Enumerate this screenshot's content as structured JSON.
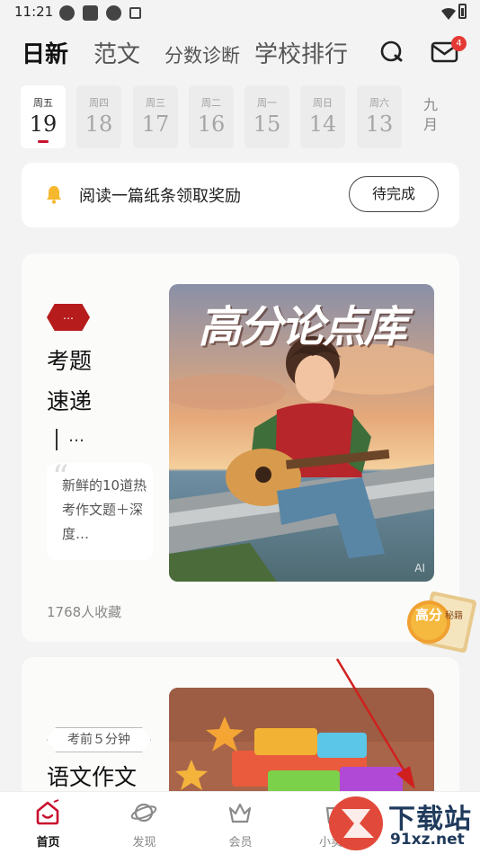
{
  "status_bar": {
    "time": "11:21"
  },
  "header": {
    "tabs": [
      "日新",
      "范文",
      "分数诊断",
      "学校排行"
    ],
    "mail_badge": "4"
  },
  "dates": [
    {
      "week": "周五",
      "day": "19",
      "active": true
    },
    {
      "week": "周四",
      "day": "18"
    },
    {
      "week": "周三",
      "day": "17"
    },
    {
      "week": "周二",
      "day": "16"
    },
    {
      "week": "周一",
      "day": "15"
    },
    {
      "week": "周日",
      "day": "14"
    },
    {
      "week": "周六",
      "day": "13"
    }
  ],
  "month_label": "九月",
  "task": {
    "text": "阅读一篇纸条领取奖励",
    "button": "待完成"
  },
  "card1": {
    "badge": "…",
    "title_line1": "考题",
    "title_line2": "速递",
    "ellipsis": "…",
    "quote": "新鲜的10道热考作文题＋深度…",
    "meta": "1768人收藏",
    "image_title": "高分论点库",
    "image_mark": "AI"
  },
  "sticker": {
    "text_main": "高分",
    "text_sub": "秘籍"
  },
  "card2": {
    "tag": "考前５分钟",
    "title": "语文作文"
  },
  "bottom_nav": [
    {
      "label": "首页",
      "icon": "home-icon",
      "active": true
    },
    {
      "label": "发现",
      "icon": "planet-icon"
    },
    {
      "label": "会员",
      "icon": "crown-icon"
    },
    {
      "label": "小卖部",
      "icon": "shop-icon"
    }
  ],
  "watermark": {
    "line1": "下载站",
    "line2": "91xz.net"
  },
  "colors": {
    "accent_red": "#c8102e",
    "badge_red": "#b71c1c",
    "bell_yellow": "#f5b82e"
  }
}
